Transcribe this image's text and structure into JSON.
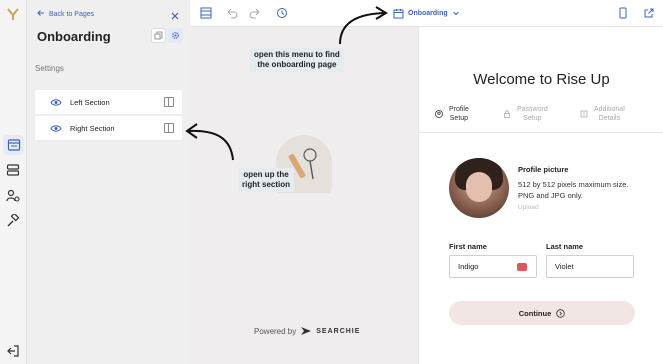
{
  "sidebar": {
    "logo": "rise-up-logo",
    "icons": [
      "pages-icon",
      "layers-icon",
      "users-settings-icon",
      "gavel-icon",
      "logout-icon"
    ]
  },
  "panel": {
    "back_label": "Back to Pages",
    "title": "Onboarding",
    "settings_label": "Settings",
    "sections": [
      {
        "label": "Left Section"
      },
      {
        "label": "Right Section"
      }
    ]
  },
  "toolbar": {
    "page_selector": "Onboarding"
  },
  "annotations": {
    "menu_note_line1": "open this menu to find",
    "menu_note_line2": "the onboarding page",
    "section_note_line1": "open up the",
    "section_note_line2": "right section"
  },
  "footer": {
    "powered_by": "Powered by",
    "brand": "SEARCHIE"
  },
  "preview": {
    "heading": "Welcome to Rise Up",
    "tabs": [
      {
        "line1": "Profile",
        "line2": "Setup"
      },
      {
        "line1": "Password",
        "line2": "Setup"
      },
      {
        "line1": "Additional",
        "line2": "Details"
      }
    ],
    "profile_picture_title": "Profile picture",
    "profile_picture_desc1": "512 by 512 pixels maximum size.",
    "profile_picture_desc2": "PNG and JPG only.",
    "upload_label": "Upload",
    "first_name_label": "First name",
    "first_name_value": "Indigo",
    "last_name_label": "Last name",
    "last_name_value": "Violet",
    "continue_label": "Continue"
  },
  "colors": {
    "accent": "#3d63b5",
    "continue_bg": "#f2e6e4",
    "annotation_bg": "#e4ecef"
  }
}
